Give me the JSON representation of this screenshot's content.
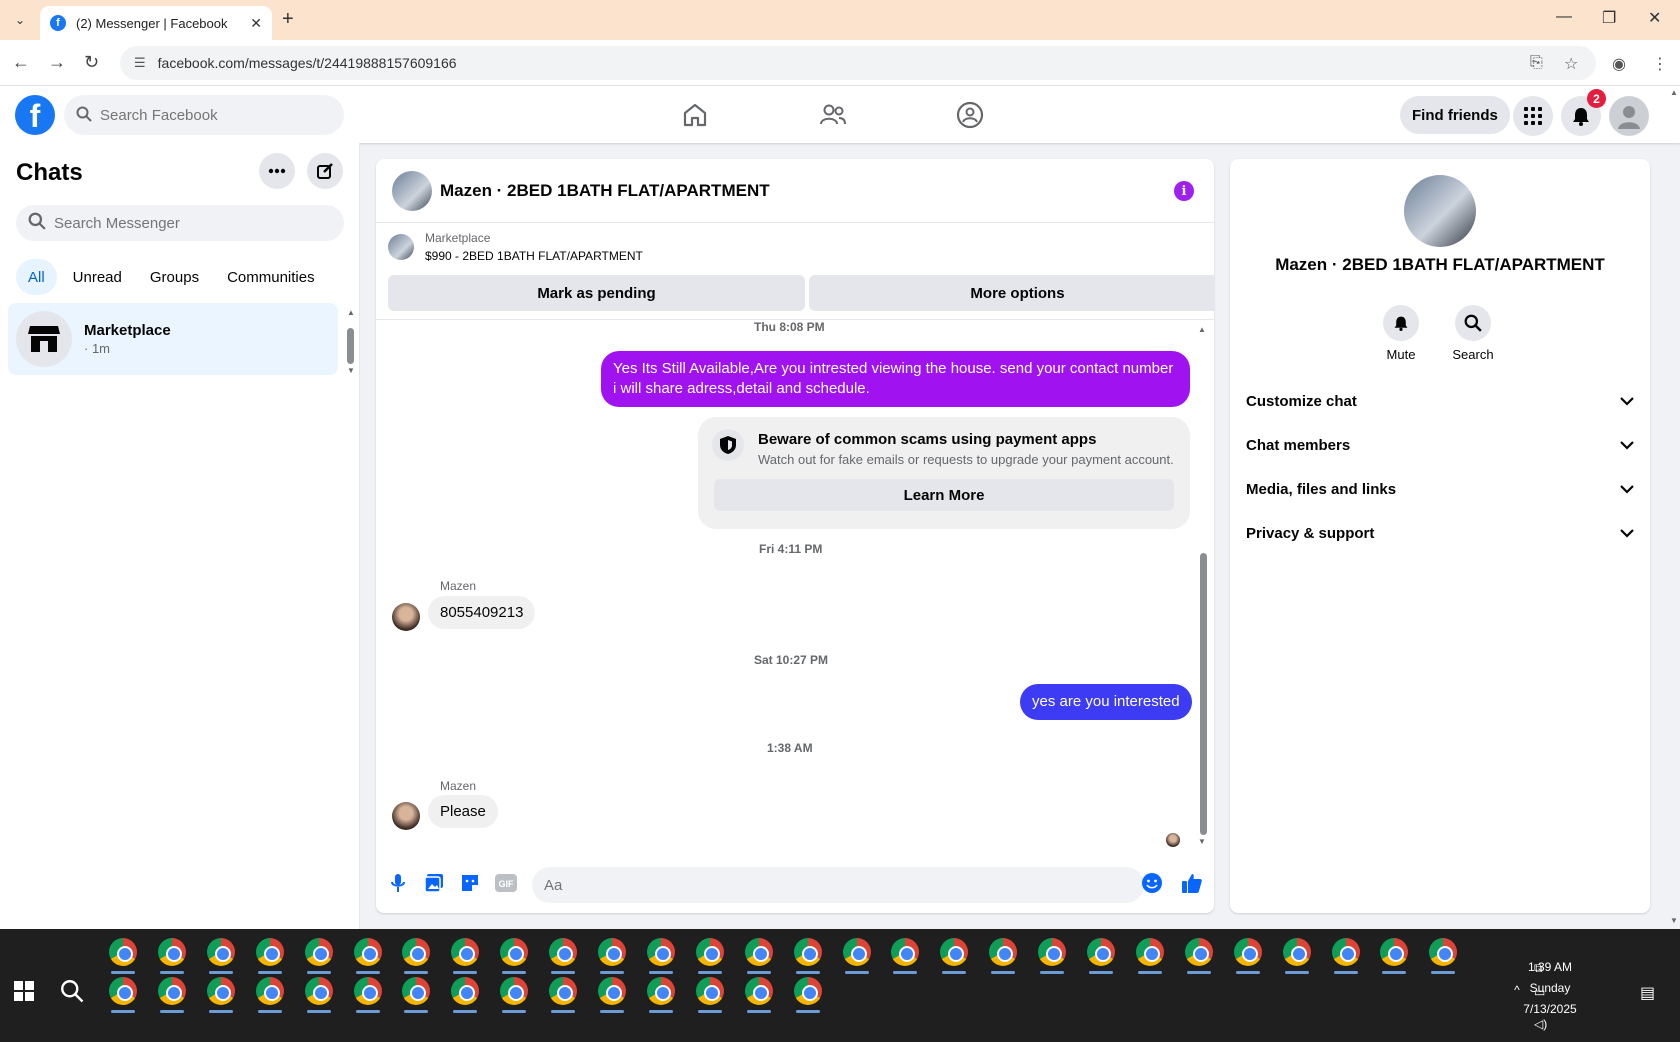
{
  "browser": {
    "tab_title": "(2) Messenger | Facebook",
    "url": "facebook.com/messages/t/24419888157609166"
  },
  "fb": {
    "search_placeholder": "Search Facebook",
    "find_friends": "Find friends",
    "notification_count": "2"
  },
  "left": {
    "title": "Chats",
    "search_placeholder": "Search Messenger",
    "filters": [
      "All",
      "Unread",
      "Groups",
      "Communities"
    ],
    "chat": {
      "name": "Marketplace",
      "time": "· 1m"
    }
  },
  "conversation": {
    "title": "Mazen · 2BED 1BATH FLAT/APARTMENT",
    "marketplace_label": "Marketplace",
    "listing": "$990 - 2BED 1BATH FLAT/APARTMENT",
    "mark_pending": "Mark as pending",
    "more_options": "More options",
    "messages": {
      "ts1": "Thu 8:08 PM",
      "out1": "Yes Its Still Available,Are you intrested viewing the house. send your contact number i will share adress,detail and schedule.",
      "scam_title": "Beware of common scams using payment apps",
      "scam_body": "Watch out for fake emails or requests to upgrade your payment account.",
      "learn_more": "Learn More",
      "ts2": "Fri 4:11 PM",
      "sender1": "Mazen",
      "in1": "8055409213",
      "ts3": "Sat 10:27 PM",
      "out2": "yes are you interested",
      "ts4": "1:38 AM",
      "sender2": "Mazen",
      "in2": "Please"
    },
    "input_placeholder": "Aa"
  },
  "right": {
    "name": "Mazen · 2BED 1BATH FLAT/APARTMENT",
    "mute": "Mute",
    "search": "Search",
    "sections": [
      "Customize chat",
      "Chat members",
      "Media, files and links",
      "Privacy & support"
    ]
  },
  "taskbar": {
    "time": "1:39 AM",
    "day": "Sunday",
    "date": "7/13/2025"
  },
  "colors": {
    "fb_blue": "#1877f2",
    "outgoing_purple": "#a112f0",
    "outgoing_blue": "#3d3bf3",
    "accent_link": "#0064d1"
  }
}
